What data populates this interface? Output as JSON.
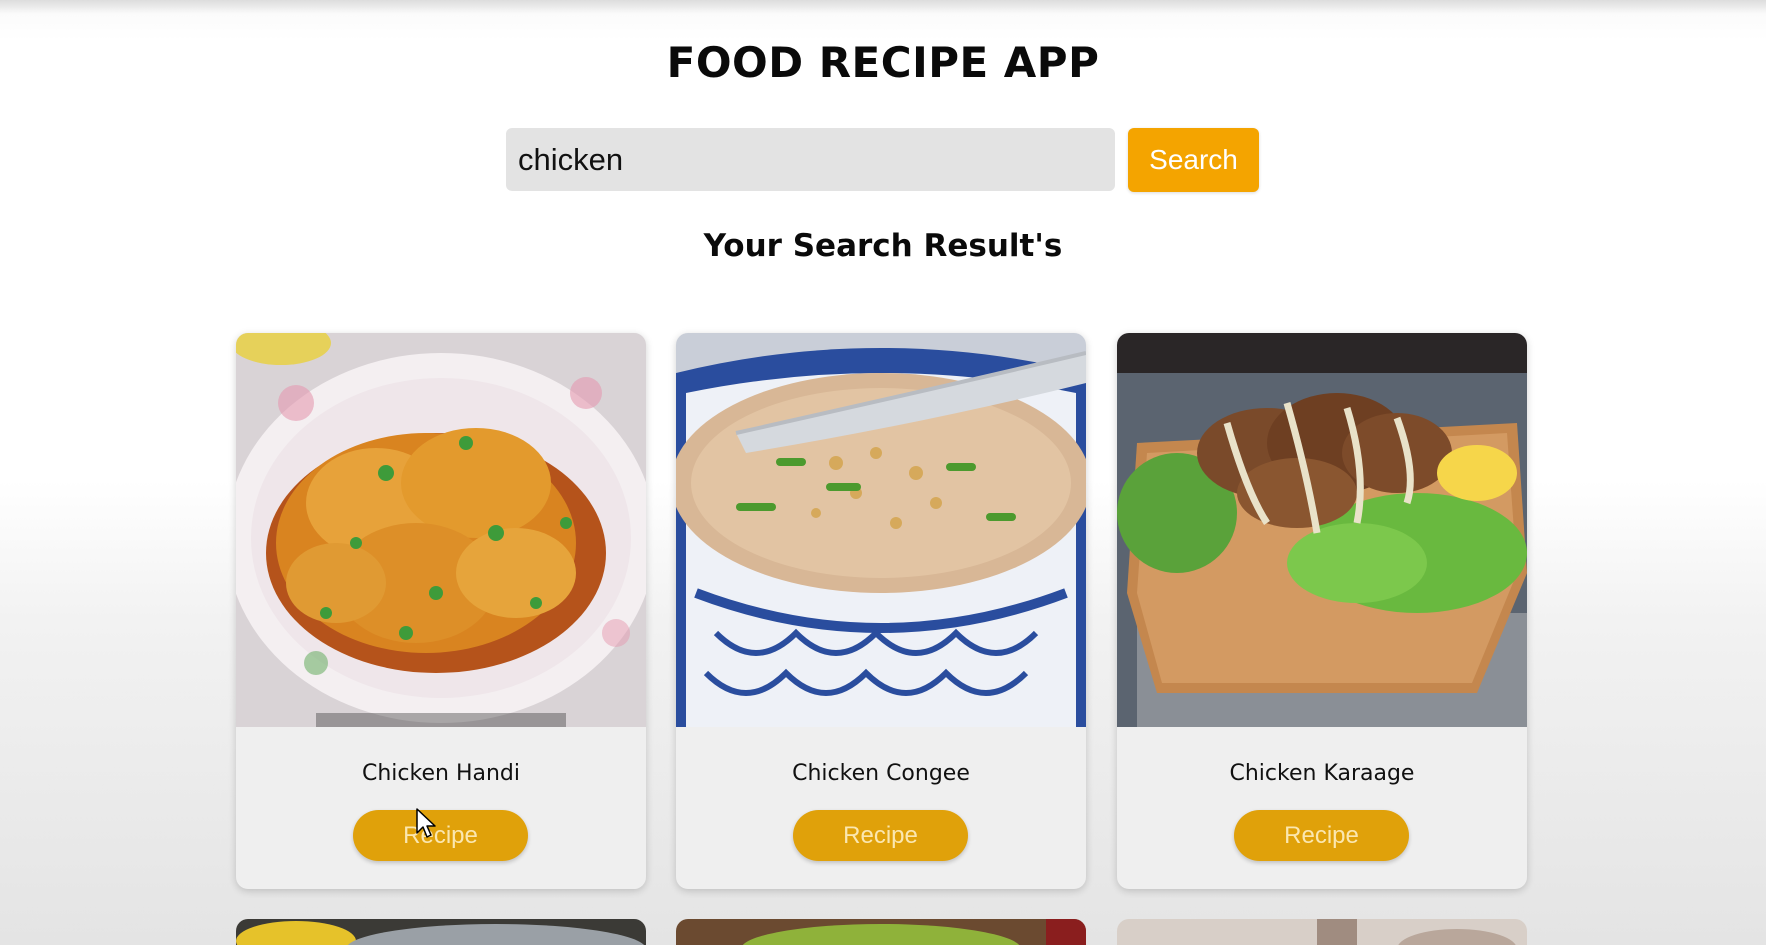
{
  "header": {
    "title": "FOOD RECIPE APP"
  },
  "search": {
    "value": "chicken",
    "button_label": "Search"
  },
  "results": {
    "heading": "Your Search Result's",
    "cards": [
      {
        "title": "Chicken Handi",
        "button_label": "Recipe"
      },
      {
        "title": "Chicken Congee",
        "button_label": "Recipe"
      },
      {
        "title": "Chicken Karaage",
        "button_label": "Recipe"
      }
    ]
  },
  "colors": {
    "accent": "#f4a400",
    "recipe_button": "#e0a10a",
    "input_background": "#e3e3e3",
    "card_background": "#efefef"
  },
  "icons": {
    "cursor": "mouse-pointer-icon"
  }
}
